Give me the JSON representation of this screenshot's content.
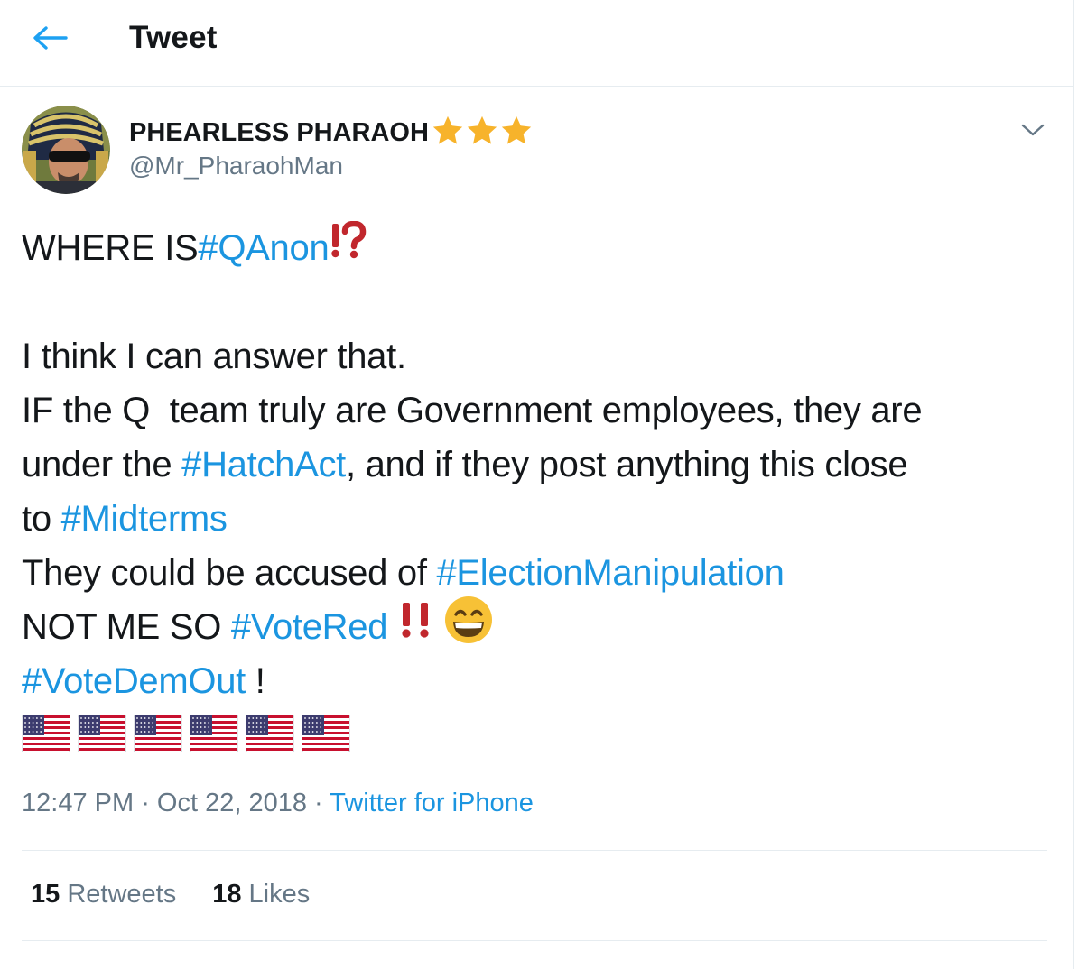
{
  "header": {
    "title": "Tweet",
    "back_icon": "arrow-left-icon"
  },
  "author": {
    "display_name": "PHEARLESS PHARAOH",
    "badge": "⭐⭐⭐",
    "handle": "@Mr_PharaohMan"
  },
  "tweet": {
    "line1_text": "WHERE IS ",
    "line1_tag": "#QAnon",
    "line1_emoji": "⁉️",
    "line2": "I think I can answer that.",
    "line3": "IF the Q  team truly are Government employees, they are",
    "line4_text": "under the ",
    "line4_tag": "#HatchAct",
    "line4_rest": ", and if they post anything this close",
    "line5_text": "to ",
    "line5_tag": "#Midterms",
    "line6_text": "They could be accused of ",
    "line6_tag": "#ElectionManipulation",
    "line7_text": "NOT ME SO ",
    "line7_tag": "#VoteRed",
    "line7_emoji": "‼️😁",
    "line8_tag": "#VoteDemOut",
    "line8_rest": " !",
    "flags": "🇺🇸🇺🇸🇺🇸🇺🇸🇺🇸🇺🇸"
  },
  "meta": {
    "time": "12:47 PM",
    "sep1": " · ",
    "date": "Oct 22, 2018",
    "sep2": " · ",
    "source": "Twitter for iPhone"
  },
  "stats": {
    "retweets_count": "15",
    "retweets_label": " Retweets",
    "likes_count": "18",
    "likes_label": " Likes"
  },
  "colors": {
    "link": "#1b95e0",
    "secondary_text": "#657786",
    "primary_text": "#14171a",
    "divider": "#e6ecf0",
    "emoji_red": "#c1272d"
  }
}
